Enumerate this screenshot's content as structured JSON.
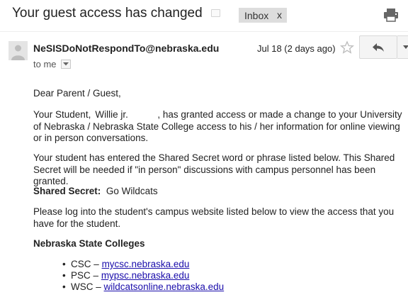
{
  "subject": "Your guest access has changed",
  "label": {
    "name": "Inbox",
    "remove": "x"
  },
  "icons": {
    "print": "printer-icon",
    "avatar": "person-icon",
    "star": "star-outline-icon",
    "reply": "reply-arrow-icon",
    "more": "chevron-down-icon",
    "to_details": "small-dropdown-icon"
  },
  "message": {
    "sender": "NeSISDoNotRespondTo@nebraska.edu",
    "date": "Jul 18 (2 days ago)",
    "to": "to me",
    "greeting": "Dear Parent / Guest,",
    "p1_before": "Your Student,",
    "student_name": "Willie jr.",
    "p1_after": ", has granted access or made a change to your University of Nebraska / Nebraska State College access to his / her information for online viewing or in person conversations.",
    "p2": "Your student has entered the Shared Secret word or phrase listed below. This Shared Secret will be needed if \"in person\" discussions with campus personnel has been granted.",
    "secret_label": "Shared Secret:",
    "secret_value": "Go Wildcats",
    "p4": "Please log into the student's campus website listed below to view the access that you have for the student.",
    "colleges_heading": "Nebraska State Colleges",
    "colleges": [
      {
        "abbr": "CSC",
        "sep": "–",
        "url": "mycsc.nebraska.edu"
      },
      {
        "abbr": "PSC",
        "sep": "–",
        "url": "mypsc.nebraska.edu"
      },
      {
        "abbr": "WSC",
        "sep": "–",
        "url": "wildcatsonline.nebraska.edu"
      }
    ]
  },
  "colors": {
    "link": "#1a0dab",
    "chip": "#dddddd",
    "button": "#f4f4f4"
  }
}
